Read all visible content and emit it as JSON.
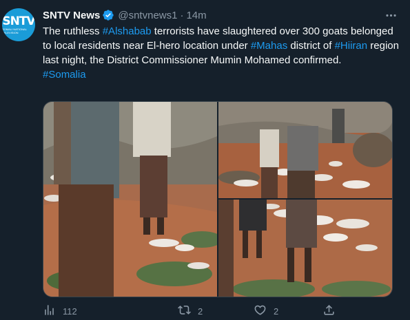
{
  "account": {
    "avatar_text": "SNTV",
    "avatar_subtext": "SOMALI NATIONAL TELEVISION",
    "name": "SNTV News",
    "handle": "@sntvnews1",
    "separator": "·",
    "time": "14m"
  },
  "tweet": {
    "t1": "The ruthless ",
    "h1": "#Alshabab",
    "t2": " terrorists have slaughtered over 300 goats belonged to local residents near El-hero location under ",
    "h2": "#Mahas",
    "t3": " district of ",
    "h3": "#Hiiran",
    "t4": " region last night, the District Commissioner Mumin Mohamed confirmed.",
    "h4": "#Somalia"
  },
  "media": {
    "photos": [
      "photo-left",
      "photo-top-right",
      "photo-bottom-right"
    ]
  },
  "actions": {
    "views_icon": "analytics-icon",
    "views": "112",
    "retweet_icon": "retweet-icon",
    "retweets": "2",
    "like_icon": "heart-icon",
    "likes": "2",
    "share_icon": "share-icon"
  },
  "colors": {
    "background": "#15202b",
    "text": "#f7f9f9",
    "secondary": "#8b98a5",
    "accent": "#1d9bf0"
  }
}
